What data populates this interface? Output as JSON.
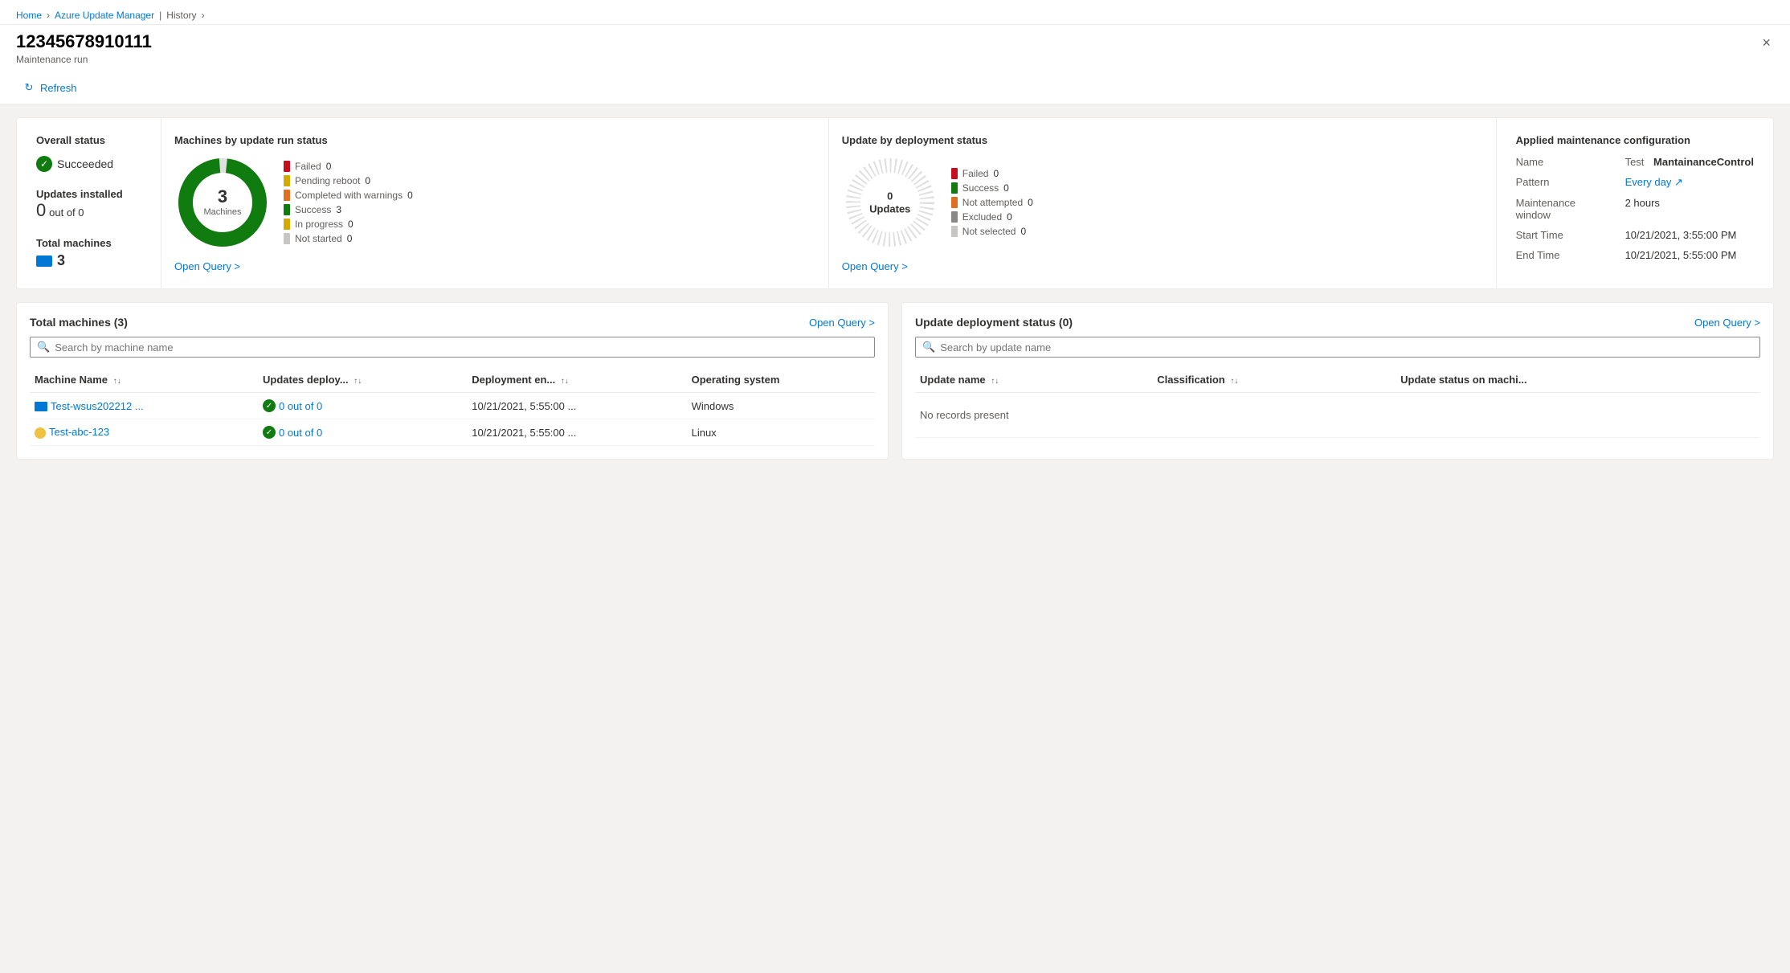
{
  "breadcrumb": {
    "home": "Home",
    "azure": "Azure Update Manager",
    "history": "History"
  },
  "header": {
    "title": "12345678910111",
    "subtitle": "Maintenance run",
    "close_label": "×"
  },
  "toolbar": {
    "refresh_label": "Refresh"
  },
  "overall_status": {
    "title": "Overall status",
    "status": "Succeeded",
    "updates_installed_label": "Updates installed",
    "updates_installed_value": "0",
    "updates_installed_suffix": "out of 0",
    "total_machines_label": "Total machines",
    "total_machines_value": "3"
  },
  "machines_chart": {
    "title": "Machines by update run status",
    "center_num": "3",
    "center_label": "Machines",
    "legend": [
      {
        "label": "Failed",
        "value": "0",
        "color": "#c50f1f"
      },
      {
        "label": "Pending reboot",
        "value": "0",
        "color": "#d4a900"
      },
      {
        "label": "Completed with warnings",
        "value": "0",
        "color": "#e07020"
      },
      {
        "label": "Success",
        "value": "3",
        "color": "#107c10"
      },
      {
        "label": "In progress",
        "value": "0",
        "color": "#d4a900"
      },
      {
        "label": "Not started",
        "value": "0",
        "color": "#c8c6c4"
      }
    ],
    "open_query": "Open Query >"
  },
  "deployment_chart": {
    "title": "Update by deployment status",
    "center_num": "0",
    "center_label": "Updates",
    "legend": [
      {
        "label": "Failed",
        "value": "0",
        "color": "#c50f1f"
      },
      {
        "label": "Success",
        "value": "0",
        "color": "#107c10"
      },
      {
        "label": "Not attempted",
        "value": "0",
        "color": "#e07020"
      },
      {
        "label": "Excluded",
        "value": "0",
        "color": "#8a8886"
      },
      {
        "label": "Not selected",
        "value": "0",
        "color": "#c8c6c4"
      }
    ],
    "open_query": "Open Query >"
  },
  "maintenance": {
    "title": "Applied maintenance configuration",
    "name_label": "Name",
    "name_prefix": "Test",
    "name_value": "MantainanceControl",
    "pattern_label": "Pattern",
    "pattern_value": "Every day",
    "window_label": "Maintenance window",
    "window_value": "2 hours",
    "start_label": "Start Time",
    "start_value": "10/21/2021, 3:55:00 PM",
    "end_label": "End Time",
    "end_value": "10/21/2021, 5:55:00 PM"
  },
  "machines_table": {
    "title": "Total machines (3)",
    "open_query": "Open Query >",
    "search_placeholder": "Search by machine name",
    "columns": [
      "Machine Name",
      "Updates deploy...",
      "Deployment en...",
      "Operating system"
    ],
    "rows": [
      {
        "name": "Test-wsus202212 ...",
        "updates": "0 out of 0",
        "deployment_end": "10/21/2021, 5:55:00 ...",
        "os": "Windows"
      },
      {
        "name": "Test-abc-123",
        "updates": "0 out of 0",
        "deployment_end": "10/21/2021, 5:55:00 ...",
        "os": "Linux"
      }
    ]
  },
  "updates_table": {
    "title": "Update deployment status (0)",
    "open_query": "Open Query >",
    "search_placeholder": "Search by update name",
    "columns": [
      "Update name",
      "Classification",
      "Update status on machi..."
    ],
    "no_records": "No records present"
  },
  "pagination": {
    "out_of_label_1": "out of 0",
    "out_of_label_2": "out of 0"
  }
}
